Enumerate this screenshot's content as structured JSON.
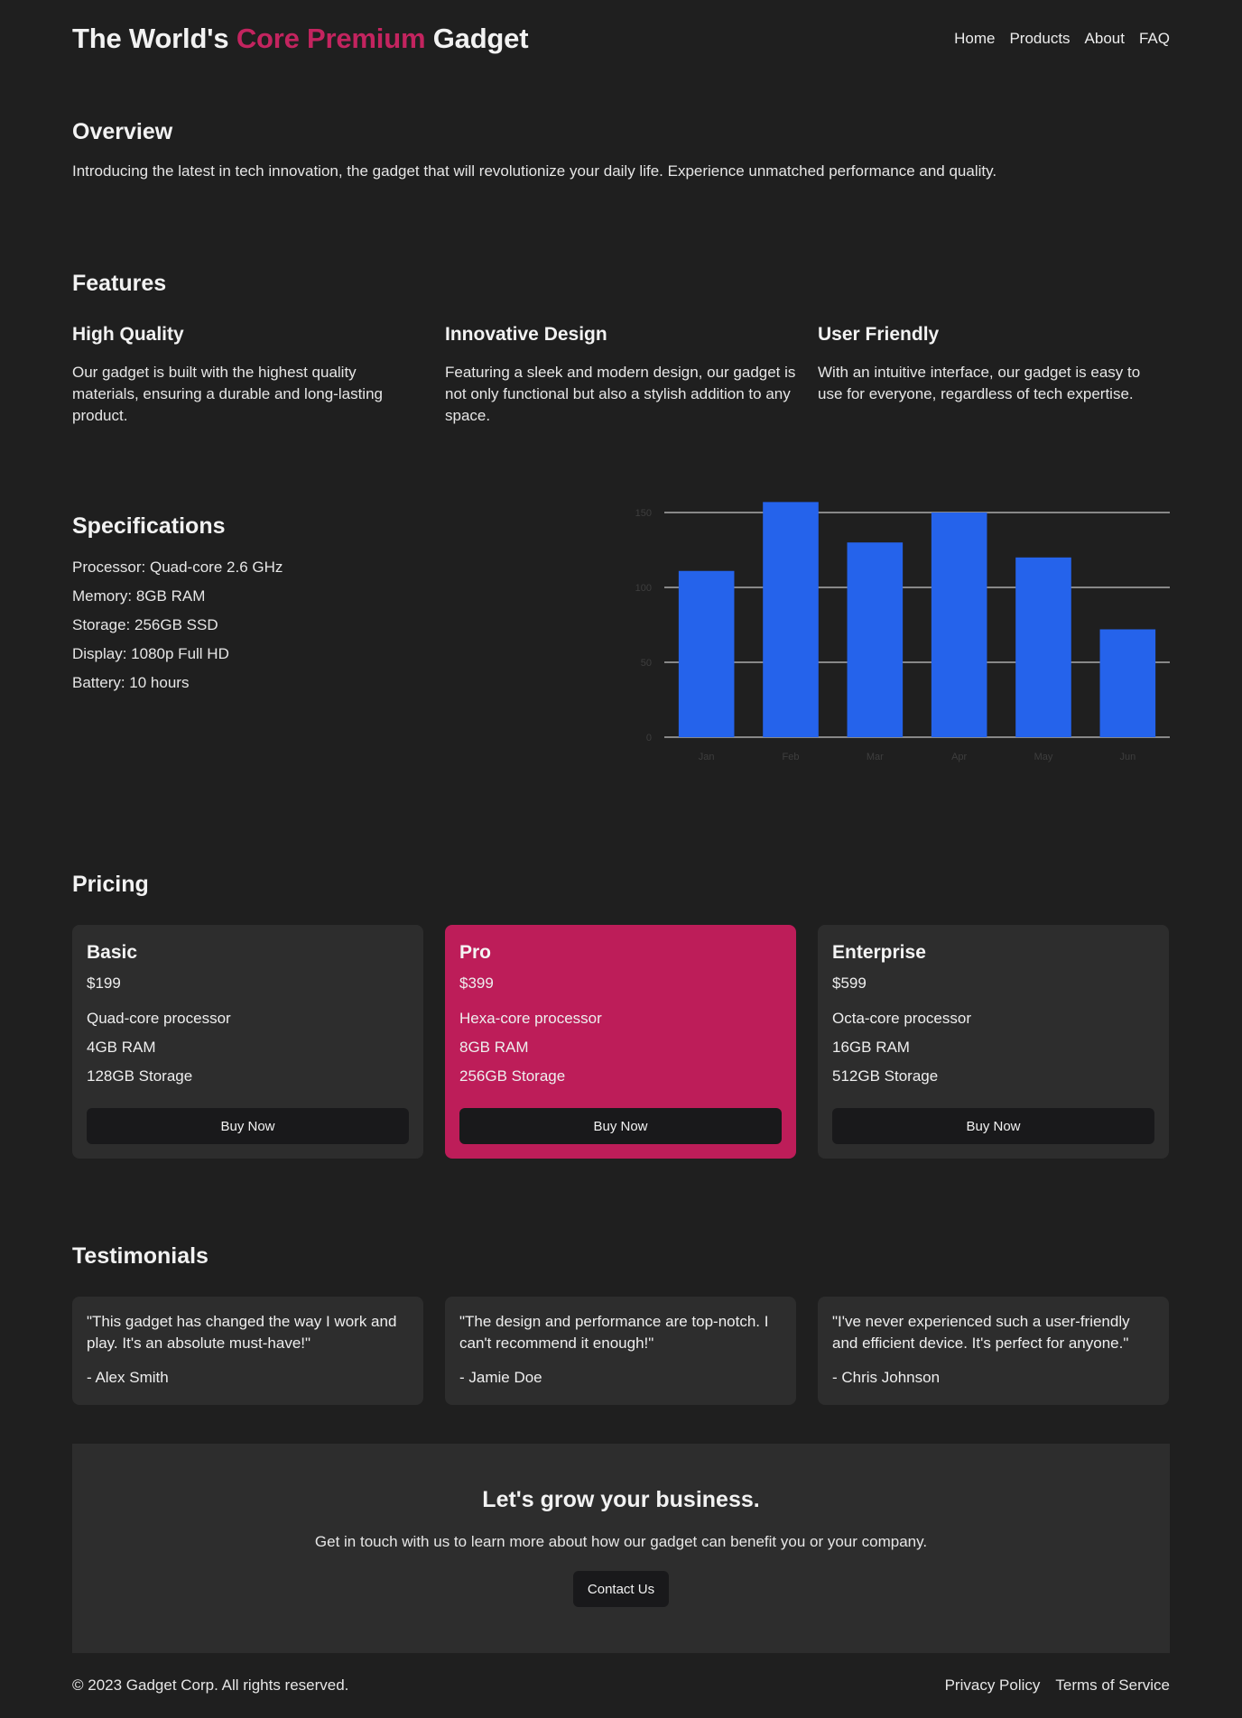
{
  "header": {
    "brand_prefix": "The World's",
    "brand_accent": "Core Premium",
    "brand_suffix": "Gadget",
    "nav": [
      "Home",
      "Products",
      "About",
      "FAQ"
    ]
  },
  "overview": {
    "title": "Overview",
    "text": "Introducing the latest in tech innovation, the gadget that will revolutionize your daily life. Experience unmatched performance and quality."
  },
  "features": {
    "title": "Features",
    "items": [
      {
        "title": "High Quality",
        "text": "Our gadget is built with the highest quality materials, ensuring a durable and long-lasting product."
      },
      {
        "title": "Innovative Design",
        "text": "Featuring a sleek and modern design, our gadget is not only functional but also a stylish addition to any space."
      },
      {
        "title": "User Friendly",
        "text": "With an intuitive interface, our gadget is easy to use for everyone, regardless of tech expertise."
      }
    ]
  },
  "specs": {
    "title": "Specifications",
    "items": [
      "Processor: Quad-core 2.6 GHz",
      "Memory: 8GB RAM",
      "Storage: 256GB SSD",
      "Display: 1080p Full HD",
      "Battery: 10 hours"
    ]
  },
  "chart_data": {
    "type": "bar",
    "categories": [
      "Jan",
      "Feb",
      "Mar",
      "Apr",
      "May",
      "Jun"
    ],
    "values": [
      111,
      157,
      130,
      150,
      120,
      72
    ],
    "yticks": [
      0,
      50,
      100,
      150
    ],
    "ylim": [
      0,
      150
    ],
    "grid": true,
    "bar_color": "#2563eb",
    "title": "",
    "xlabel": "",
    "ylabel": ""
  },
  "pricing": {
    "title": "Pricing",
    "plans": [
      {
        "name": "Basic",
        "price": "$199",
        "features": [
          "Quad-core processor",
          "4GB RAM",
          "128GB Storage"
        ],
        "button": "Buy Now"
      },
      {
        "name": "Pro",
        "price": "$399",
        "features": [
          "Hexa-core processor",
          "8GB RAM",
          "256GB Storage"
        ],
        "button": "Buy Now"
      },
      {
        "name": "Enterprise",
        "price": "$599",
        "features": [
          "Octa-core processor",
          "16GB RAM",
          "512GB Storage"
        ],
        "button": "Buy Now"
      }
    ]
  },
  "testimonials": {
    "title": "Testimonials",
    "items": [
      {
        "quote": "\"This gadget has changed the way I work and play. It's an absolute must-have!\"",
        "author": "- Alex Smith"
      },
      {
        "quote": "\"The design and performance are top-notch. I can't recommend it enough!\"",
        "author": "- Jamie Doe"
      },
      {
        "quote": "\"I've never experienced such a user-friendly and efficient device. It's perfect for anyone.\"",
        "author": "- Chris Johnson"
      }
    ]
  },
  "cta": {
    "title": "Let's grow your business.",
    "text": "Get in touch with us to learn more about how our gadget can benefit you or your company.",
    "button": "Contact Us"
  },
  "footer": {
    "copyright": "© 2023 Gadget Corp. All rights reserved.",
    "links": [
      "Privacy Policy",
      "Terms of Service"
    ]
  },
  "colors": {
    "background": "#1f1f1f",
    "card": "#2d2d2d",
    "accent": "#c3245f",
    "featured_card": "#bd1d59",
    "button": "#19191b",
    "bar": "#2563eb"
  }
}
